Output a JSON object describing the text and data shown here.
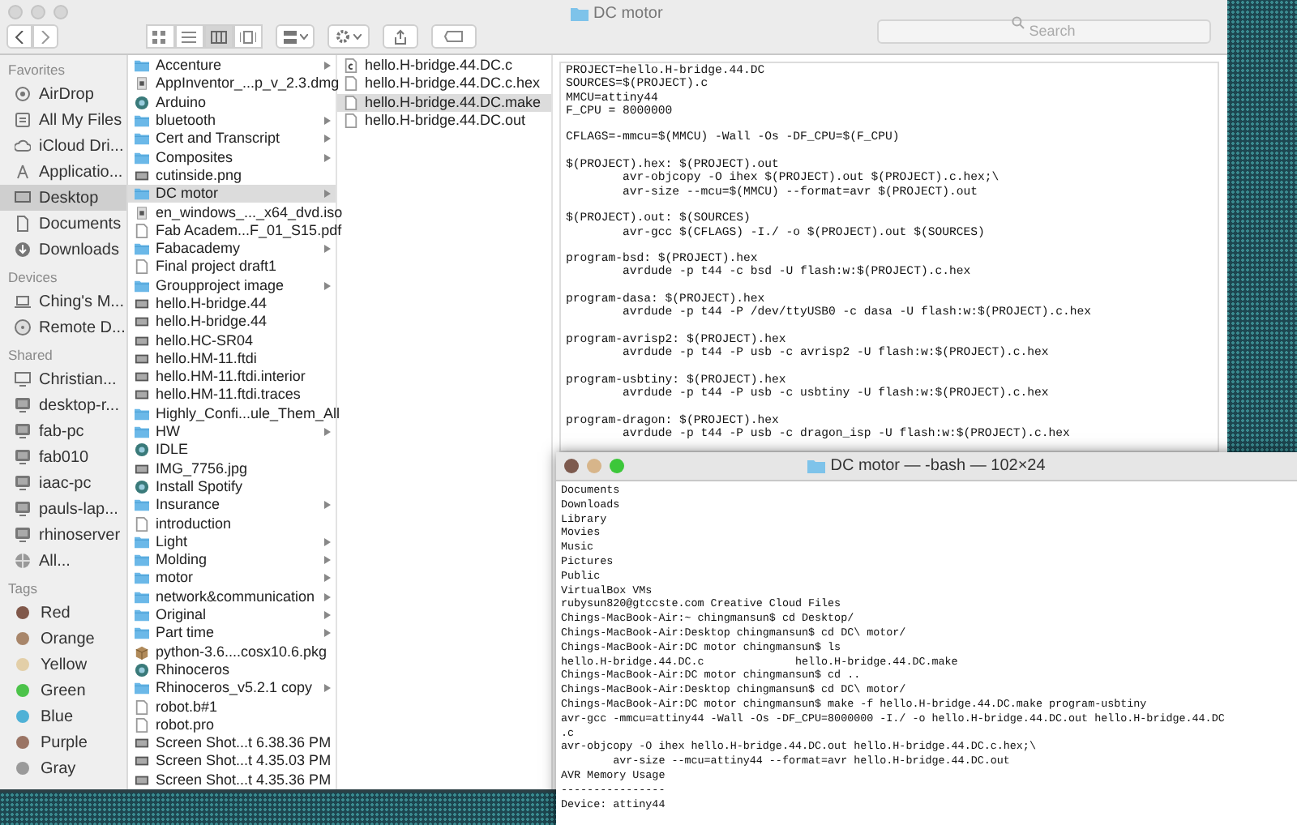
{
  "finder": {
    "title": "DC motor",
    "search": {
      "placeholder": "Search"
    },
    "view_modes": [
      {
        "kind": "icons",
        "selected": false
      },
      {
        "kind": "list",
        "selected": false
      },
      {
        "kind": "columns",
        "selected": true
      },
      {
        "kind": "gallery",
        "selected": false
      }
    ]
  },
  "sidebar": {
    "sections": [
      {
        "heading": "Favorites",
        "items": [
          {
            "label": "AirDrop",
            "kind": "airdrop",
            "selected": false
          },
          {
            "label": "All My Files",
            "kind": "files",
            "selected": false
          },
          {
            "label": "iCloud Dri...",
            "kind": "cloud",
            "selected": false
          },
          {
            "label": "Applicatio...",
            "kind": "apps",
            "selected": false
          },
          {
            "label": "Desktop",
            "kind": "desktop",
            "selected": true
          },
          {
            "label": "Documents",
            "kind": "documents",
            "selected": false
          },
          {
            "label": "Downloads",
            "kind": "downloads",
            "selected": false
          }
        ]
      },
      {
        "heading": "Devices",
        "items": [
          {
            "label": "Ching's M...",
            "kind": "laptop",
            "selected": false
          },
          {
            "label": "Remote D...",
            "kind": "disc",
            "selected": false
          }
        ]
      },
      {
        "heading": "Shared",
        "items": [
          {
            "label": "Christian...",
            "kind": "display",
            "selected": false
          },
          {
            "label": "desktop-r...",
            "kind": "computer",
            "selected": false
          },
          {
            "label": "fab-pc",
            "kind": "computer",
            "selected": false
          },
          {
            "label": "fab010",
            "kind": "computer",
            "selected": false
          },
          {
            "label": "iaac-pc",
            "kind": "computer",
            "selected": false
          },
          {
            "label": "pauls-lap...",
            "kind": "computer",
            "selected": false
          },
          {
            "label": "rhinoserver",
            "kind": "computer",
            "selected": false
          },
          {
            "label": "All...",
            "kind": "globe",
            "selected": false
          }
        ]
      },
      {
        "heading": "Tags",
        "items": [
          {
            "label": "Red",
            "kind": "tag",
            "color": "#80584a"
          },
          {
            "label": "Orange",
            "kind": "tag",
            "color": "#a8866a"
          },
          {
            "label": "Yellow",
            "kind": "tag",
            "color": "#e3cfa8"
          },
          {
            "label": "Green",
            "kind": "tag",
            "color": "#4cc34a"
          },
          {
            "label": "Blue",
            "kind": "tag",
            "color": "#4fb1d6"
          },
          {
            "label": "Purple",
            "kind": "tag",
            "color": "#9a7464"
          },
          {
            "label": "Gray",
            "kind": "tag",
            "color": "#9a9a9a"
          }
        ]
      }
    ]
  },
  "columns": [
    {
      "items": [
        {
          "label": "Accenture",
          "kind": "folder",
          "selected": false
        },
        {
          "label": "AppInventor_...p_v_2.3.dmg",
          "kind": "disk",
          "selected": false
        },
        {
          "label": "Arduino",
          "kind": "app",
          "selected": false
        },
        {
          "label": "bluetooth",
          "kind": "folder",
          "selected": false
        },
        {
          "label": "Cert and Transcript",
          "kind": "folder",
          "selected": false
        },
        {
          "label": "Composites",
          "kind": "folder",
          "selected": false
        },
        {
          "label": "cutinside.png",
          "kind": "image",
          "selected": false
        },
        {
          "label": "DC motor",
          "kind": "folder",
          "selected": true
        },
        {
          "label": "en_windows_..._x64_dvd.iso",
          "kind": "disk",
          "selected": false
        },
        {
          "label": "Fab Academ...F_01_S15.pdf",
          "kind": "file",
          "selected": false
        },
        {
          "label": "Fabacademy",
          "kind": "folder",
          "selected": false
        },
        {
          "label": "Final project draft1",
          "kind": "file",
          "selected": false
        },
        {
          "label": "Groupproject image",
          "kind": "folder",
          "selected": false
        },
        {
          "label": "hello.H-bridge.44",
          "kind": "image",
          "selected": false
        },
        {
          "label": "hello.H-bridge.44",
          "kind": "image",
          "selected": false
        },
        {
          "label": "hello.HC-SR04",
          "kind": "image",
          "selected": false
        },
        {
          "label": "hello.HM-11.ftdi",
          "kind": "image",
          "selected": false
        },
        {
          "label": "hello.HM-11.ftdi.interior",
          "kind": "image",
          "selected": false
        },
        {
          "label": "hello.HM-11.ftdi.traces",
          "kind": "image",
          "selected": false
        },
        {
          "label": "Highly_Confi...ule_Them_All",
          "kind": "folder",
          "selected": false
        },
        {
          "label": "HW",
          "kind": "folder",
          "selected": false
        },
        {
          "label": "IDLE",
          "kind": "app",
          "selected": false
        },
        {
          "label": "IMG_7756.jpg",
          "kind": "image",
          "selected": false
        },
        {
          "label": "Install Spotify",
          "kind": "app",
          "selected": false
        },
        {
          "label": "Insurance",
          "kind": "folder",
          "selected": false
        },
        {
          "label": "introduction",
          "kind": "file",
          "selected": false
        },
        {
          "label": "Light",
          "kind": "folder",
          "selected": false
        },
        {
          "label": "Molding",
          "kind": "folder",
          "selected": false
        },
        {
          "label": "motor",
          "kind": "folder",
          "selected": false
        },
        {
          "label": "network&communication",
          "kind": "folder",
          "selected": false
        },
        {
          "label": "Original",
          "kind": "folder",
          "selected": false
        },
        {
          "label": "Part time",
          "kind": "folder",
          "selected": false
        },
        {
          "label": "python-3.6....cosx10.6.pkg",
          "kind": "package",
          "selected": false
        },
        {
          "label": "Rhinoceros",
          "kind": "app",
          "selected": false
        },
        {
          "label": "Rhinoceros_v5.2.1 copy",
          "kind": "folder",
          "selected": false
        },
        {
          "label": "robot.b#1",
          "kind": "file",
          "selected": false
        },
        {
          "label": "robot.pro",
          "kind": "file",
          "selected": false
        },
        {
          "label": "Screen Shot...t 6.38.36 PM",
          "kind": "image",
          "selected": false
        },
        {
          "label": "Screen Shot...t 4.35.03 PM",
          "kind": "image",
          "selected": false
        },
        {
          "label": "Screen Shot...t 4.35.36 PM",
          "kind": "image",
          "selected": false
        }
      ]
    },
    {
      "items": [
        {
          "label": "hello.H-bridge.44.DC.c",
          "kind": "source",
          "selected": false
        },
        {
          "label": "hello.H-bridge.44.DC.c.hex",
          "kind": "file",
          "selected": false
        },
        {
          "label": "hello.H-bridge.44.DC.make",
          "kind": "file",
          "selected": true
        },
        {
          "label": "hello.H-bridge.44.DC.out",
          "kind": "file",
          "selected": false
        }
      ]
    }
  ],
  "preview": {
    "stanzas": [
      [
        "PROJECT=hello.H-bridge.44.DC",
        "SOURCES=$(PROJECT).c",
        "MMCU=attiny44",
        "F_CPU = 8000000"
      ],
      [
        "CFLAGS=-mmcu=$(MMCU) -Wall -Os -DF_CPU=$(F_CPU)"
      ],
      [
        "$(PROJECT).hex: $(PROJECT).out",
        "        avr-objcopy -O ihex $(PROJECT).out $(PROJECT).c.hex;\\",
        "        avr-size --mcu=$(MMCU) --format=avr $(PROJECT).out"
      ],
      [
        "$(PROJECT).out: $(SOURCES)",
        "        avr-gcc $(CFLAGS) -I./ -o $(PROJECT).out $(SOURCES)"
      ],
      [
        "program-bsd: $(PROJECT).hex",
        "        avrdude -p t44 -c bsd -U flash:w:$(PROJECT).c.hex"
      ],
      [
        "program-dasa: $(PROJECT).hex",
        "        avrdude -p t44 -P /dev/ttyUSB0 -c dasa -U flash:w:$(PROJECT).c.hex"
      ],
      [
        "program-avrisp2: $(PROJECT).hex",
        "        avrdude -p t44 -P usb -c avrisp2 -U flash:w:$(PROJECT).c.hex"
      ],
      [
        "program-usbtiny: $(PROJECT).hex",
        "        avrdude -p t44 -P usb -c usbtiny -U flash:w:$(PROJECT).c.hex"
      ],
      [
        "program-dragon: $(PROJECT).hex",
        "        avrdude -p t44 -P usb -c dragon_isp -U flash:w:$(PROJECT).c.hex"
      ]
    ]
  },
  "terminal": {
    "title": "DC motor — -bash — 102×24",
    "lines": [
      "Documents",
      "Downloads",
      "Library",
      "Movies",
      "Music",
      "Pictures",
      "Public",
      "VirtualBox VMs",
      "rubysun820@gtccste.com Creative Cloud Files",
      "Chings-MacBook-Air:~ chingmansun$ cd Desktop/",
      "Chings-MacBook-Air:Desktop chingmansun$ cd DC\\ motor/",
      "Chings-MacBook-Air:DC motor chingmansun$ ls",
      "hello.H-bridge.44.DC.c              hello.H-bridge.44.DC.make",
      "Chings-MacBook-Air:DC motor chingmansun$ cd ..",
      "Chings-MacBook-Air:Desktop chingmansun$ cd DC\\ motor/",
      "Chings-MacBook-Air:DC motor chingmansun$ make -f hello.H-bridge.44.DC.make program-usbtiny",
      "avr-gcc -mmcu=attiny44 -Wall -Os -DF_CPU=8000000 -I./ -o hello.H-bridge.44.DC.out hello.H-bridge.44.DC",
      ".c",
      "avr-objcopy -O ihex hello.H-bridge.44.DC.out hello.H-bridge.44.DC.c.hex;\\",
      "        avr-size --mcu=attiny44 --format=avr hello.H-bridge.44.DC.out",
      "AVR Memory Usage",
      "----------------",
      "Device: attiny44"
    ]
  }
}
